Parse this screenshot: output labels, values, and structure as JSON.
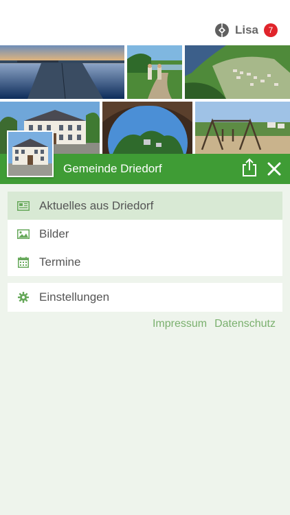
{
  "user": {
    "name": "Lisa",
    "badge_count": "7"
  },
  "collage": {
    "photos": [
      "lake-dock-photo",
      "hikers-photo",
      "aerial-village-photo",
      "town-hall-photo",
      "tree-arch-photo",
      "playground-photo"
    ]
  },
  "header": {
    "title": "Gemeinde Driedorf"
  },
  "menu": {
    "items": [
      {
        "label": "Aktuelles aus Driedorf",
        "icon": "newspaper-icon",
        "active": true
      },
      {
        "label": "Bilder",
        "icon": "image-icon",
        "active": false
      },
      {
        "label": "Termine",
        "icon": "calendar-icon",
        "active": false
      }
    ],
    "settings": {
      "label": "Einstellungen",
      "icon": "gear-icon"
    }
  },
  "footer": {
    "impressum": "Impressum",
    "datenschutz": "Datenschutz"
  },
  "colors": {
    "brand_green": "#3f9c35",
    "active_row": "#d8e9d4",
    "link_green": "#7ab06e",
    "icon_green": "#66a85a",
    "background": "#eef4ec",
    "badge_red": "#e0242b"
  }
}
